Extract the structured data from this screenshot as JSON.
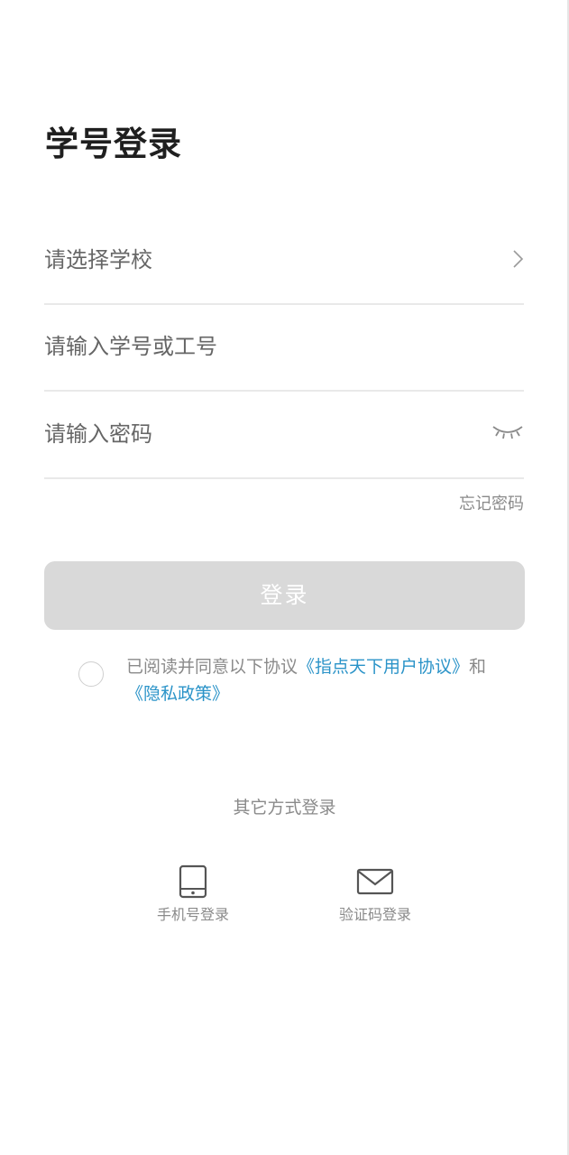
{
  "page": {
    "title": "学号登录"
  },
  "form": {
    "school_placeholder": "请选择学校",
    "id_placeholder": "请输入学号或工号",
    "password_placeholder": "请输入密码",
    "forgot_password": "忘记密码",
    "login_button": "登录"
  },
  "agreement": {
    "prefix": "已阅读并同意以下协议",
    "user_agreement": "《指点天下用户协议》",
    "conjunction": "和",
    "privacy_policy": "《隐私政策》",
    "checked": false
  },
  "other_login": {
    "title": "其它方式登录",
    "options": [
      {
        "label": "手机号登录",
        "icon": "phone-icon"
      },
      {
        "label": "验证码登录",
        "icon": "mail-icon"
      }
    ]
  },
  "colors": {
    "link": "#2a93c8",
    "button_disabled": "#d9d9d9",
    "muted_text": "#8a8a8a"
  }
}
